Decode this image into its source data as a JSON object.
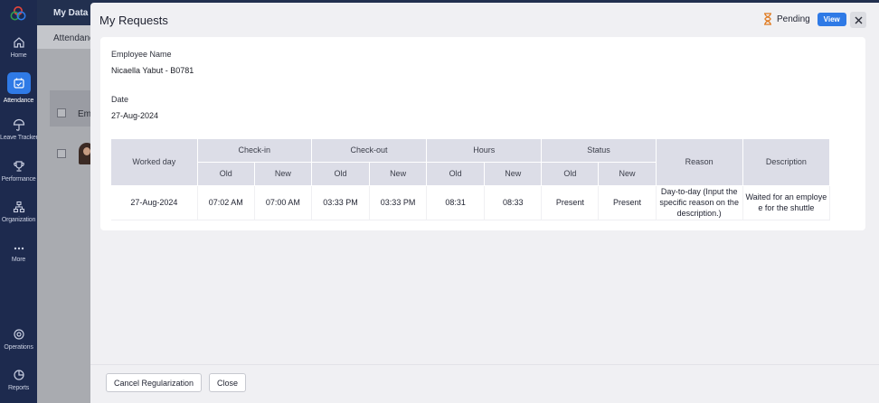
{
  "sidebar": {
    "items": [
      {
        "label": "Home"
      },
      {
        "label": "Attendance"
      },
      {
        "label": "Leave Tracker"
      },
      {
        "label": "Performance"
      },
      {
        "label": "Organization"
      },
      {
        "label": "More"
      },
      {
        "label": "Operations"
      },
      {
        "label": "Reports"
      }
    ],
    "active": "Attendance"
  },
  "background": {
    "top_title": "My Data",
    "sub_tab": "Attendanc",
    "col_header": "Em"
  },
  "modal": {
    "title": "My Requests",
    "status": "Pending",
    "view_label": "View",
    "employee_label": "Employee Name",
    "employee_value": "Nicaella Yabut - B0781",
    "date_label": "Date",
    "date_value": "27-Aug-2024",
    "table": {
      "headers": {
        "worked_day": "Worked day",
        "check_in": "Check-in",
        "check_out": "Check-out",
        "hours": "Hours",
        "status": "Status",
        "reason": "Reason",
        "description": "Description",
        "old": "Old",
        "new": "New"
      },
      "row": {
        "worked_day": "27-Aug-2024",
        "check_in_old": "07:02 AM",
        "check_in_new": "07:00 AM",
        "check_out_old": "03:33 PM",
        "check_out_new": "03:33 PM",
        "hours_old": "08:31",
        "hours_new": "08:33",
        "status_old": "Present",
        "status_new": "Present",
        "reason": "Day-to-day (Input the specific reason on the description.)",
        "description": "Waited for an employee for the shuttle"
      }
    },
    "footer": {
      "cancel_label": "Cancel Regularization",
      "close_label": "Close"
    }
  },
  "colors": {
    "rail": "#1d2a4e",
    "accent": "#2f7ae6",
    "pending": "#e07a1f",
    "table_header": "#dcdde7"
  }
}
